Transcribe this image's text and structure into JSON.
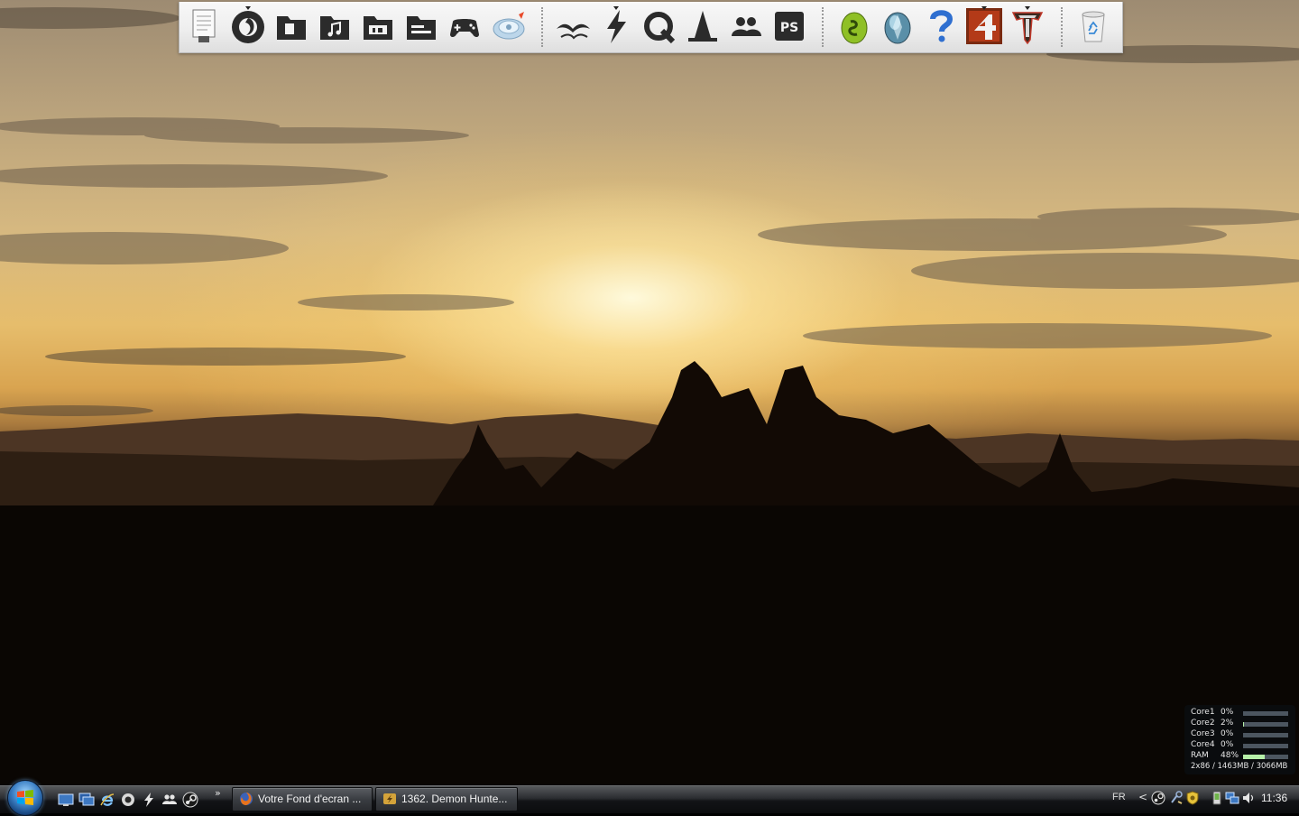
{
  "desktop": {
    "wallpaper": "sunset-landscape",
    "dock": {
      "groups": [
        [
          "notepad-icon",
          "firefox-icon",
          "documents-folder-icon",
          "music-folder-icon",
          "video-folder-icon",
          "files-folder-icon",
          "games-gamepad-icon",
          "disc-burner-icon"
        ],
        [
          "openoffice-gulls-icon",
          "winamp-bolt-icon",
          "quicktime-q-icon",
          "vlc-cone-icon",
          "messenger-buddies-icon",
          "photoshop-ps-icon"
        ],
        [
          "spore-egg-icon",
          "crystal-egg-icon",
          "help-question-icon",
          "left4dead-icon",
          "tabula-rasa-icon"
        ],
        [
          "recycle-bin-icon"
        ]
      ],
      "photoshop_label": "PS",
      "l4d_label": "4"
    }
  },
  "gadget": {
    "rows": [
      {
        "label": "Core1",
        "value": "0%",
        "level": 0
      },
      {
        "label": "Core2",
        "value": "2%",
        "level": 0.02
      },
      {
        "label": "Core3",
        "value": "0%",
        "level": 0
      },
      {
        "label": "Core4",
        "value": "0%",
        "level": 0
      },
      {
        "label": "RAM",
        "value": "48%",
        "level": 0.48
      }
    ],
    "summary": "2x86 / 1463MB / 3066MB",
    "fill_color": "#b6f0a8",
    "ram_fill_color": "#b6f0a8"
  },
  "taskbar": {
    "quick_launch": [
      "show-desktop-icon",
      "switch-windows-icon",
      "internet-explorer-icon",
      "firefox-small-icon",
      "winamp-small-icon",
      "messenger-small-icon",
      "steam-small-icon"
    ],
    "more_label": "»",
    "tasks": [
      {
        "label": "Votre Fond d'ecran ...",
        "icon": "firefox-icon"
      },
      {
        "label": "1362. Demon Hunte...",
        "icon": "winamp-icon"
      }
    ],
    "language": "FR",
    "tray_arrow": "<",
    "tray_icons": [
      "steam-tray-icon",
      "network-tool-icon",
      "security-shield-icon",
      "device-icon",
      "network-icon",
      "volume-icon"
    ],
    "clock": "11:36"
  }
}
